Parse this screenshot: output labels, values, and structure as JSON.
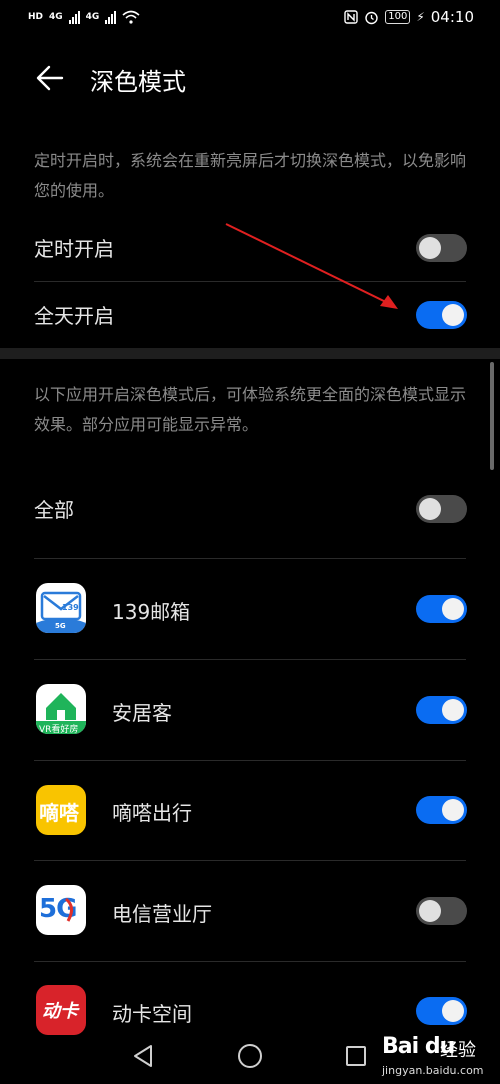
{
  "status_bar": {
    "hd_label": "HD",
    "net1": "4G",
    "net2": "4G",
    "battery": "100",
    "time": "04:10"
  },
  "header": {
    "title": "深色模式"
  },
  "schedule_desc": "定时开启时，系统会在重新亮屏后才切换深色模式，以免影响您的使用。",
  "settings": [
    {
      "label": "定时开启",
      "enabled": false
    },
    {
      "label": "全天开启",
      "enabled": true
    }
  ],
  "apps_desc": "以下应用开启深色模式后，可体验系统更全面的深色模式显示效果。部分应用可能显示异常。",
  "all_apps": {
    "label": "全部",
    "enabled": false
  },
  "apps": [
    {
      "name": "139邮箱",
      "enabled": true,
      "icon": "mail-139-icon",
      "icon_text": "139",
      "icon_sub": "5G"
    },
    {
      "name": "安居客",
      "enabled": true,
      "icon": "house-icon",
      "icon_text": "VR看好房"
    },
    {
      "name": "嘀嗒出行",
      "enabled": true,
      "icon": "dida-icon",
      "icon_text": "嘀嗒"
    },
    {
      "name": "电信营业厅",
      "enabled": false,
      "icon": "5g-hello-icon",
      "icon_text": "5G"
    },
    {
      "name": "动卡空间",
      "enabled": true,
      "icon": "dongka-icon",
      "icon_text": "动卡"
    }
  ],
  "colors": {
    "toggle_on": "#0a6cf2",
    "toggle_off": "#4a4a4a",
    "annotation_arrow": "#e02020"
  },
  "watermark": {
    "logo": "Bai du",
    "text": "经验",
    "url": "jingyan.baidu.com"
  }
}
